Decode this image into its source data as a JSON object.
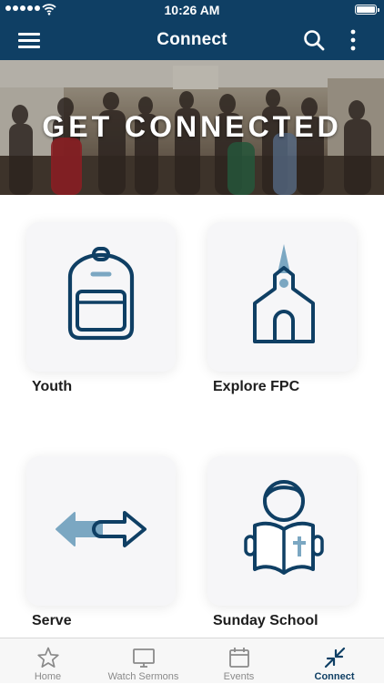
{
  "status_bar": {
    "time": "10:26 AM"
  },
  "nav": {
    "title": "Connect"
  },
  "hero": {
    "title": "GET CONNECTED"
  },
  "tiles": [
    {
      "label": "Youth",
      "icon": "backpack-icon"
    },
    {
      "label": "Explore FPC",
      "icon": "church-icon"
    },
    {
      "label": "Serve",
      "icon": "arrows-icon"
    },
    {
      "label": "Sunday School",
      "icon": "reading-child-icon"
    }
  ],
  "tabbar": {
    "tabs": [
      {
        "label": "Home",
        "icon": "star-icon"
      },
      {
        "label": "Watch Sermons",
        "icon": "monitor-icon"
      },
      {
        "label": "Events",
        "icon": "calendar-icon"
      },
      {
        "label": "Connect",
        "icon": "collapse-arrows-icon",
        "active": true
      }
    ]
  },
  "colors": {
    "brand": "#0f3f64",
    "accent": "#7ba7c2",
    "tile_bg": "#f6f6f8"
  }
}
